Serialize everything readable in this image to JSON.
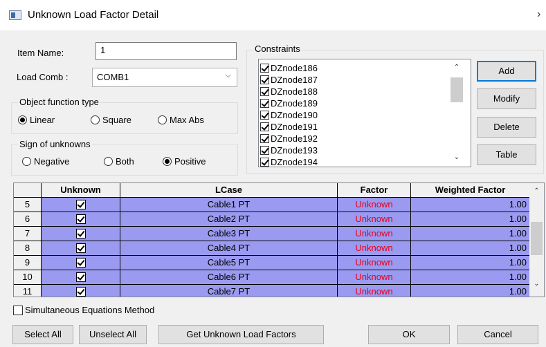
{
  "window": {
    "title": "Unknown Load Factor Detail",
    "close_glyph": "›"
  },
  "form": {
    "item_name_label": "Item Name:",
    "item_name_value": "1",
    "load_comb_label": "Load Comb :",
    "load_comb_value": "COMB1"
  },
  "objective": {
    "label": "Object function type",
    "options": [
      "Linear",
      "Square",
      "Max Abs"
    ],
    "selected": "Linear"
  },
  "sign": {
    "label": "Sign of unknowns",
    "options": [
      "Negative",
      "Both",
      "Positive"
    ],
    "selected": "Positive"
  },
  "constraints": {
    "label": "Constraints",
    "items": [
      "DZnode186",
      "DZnode187",
      "DZnode188",
      "DZnode189",
      "DZnode190",
      "DZnode191",
      "DZnode192",
      "DZnode193",
      "DZnode194"
    ],
    "buttons": [
      "Add",
      "Modify",
      "Delete",
      "Table"
    ]
  },
  "grid": {
    "columns": [
      "Unknown",
      "LCase",
      "Factor",
      "Weighted Factor"
    ],
    "rows": [
      {
        "num": "5",
        "lcase": "Cable1 PT",
        "factor": "Unknown",
        "weighted": "1.00"
      },
      {
        "num": "6",
        "lcase": "Cable2 PT",
        "factor": "Unknown",
        "weighted": "1.00"
      },
      {
        "num": "7",
        "lcase": "Cable3 PT",
        "factor": "Unknown",
        "weighted": "1.00"
      },
      {
        "num": "8",
        "lcase": "Cable4 PT",
        "factor": "Unknown",
        "weighted": "1.00"
      },
      {
        "num": "9",
        "lcase": "Cable5 PT",
        "factor": "Unknown",
        "weighted": "1.00"
      },
      {
        "num": "10",
        "lcase": "Cable6 PT",
        "factor": "Unknown",
        "weighted": "1.00"
      },
      {
        "num": "11",
        "lcase": "Cable7 PT",
        "factor": "Unknown",
        "weighted": "1.00"
      }
    ]
  },
  "simultaneous_label": "Simultaneous Equations Method",
  "footer": {
    "select_all": "Select All",
    "unselect_all": "Unselect All",
    "get_factors": "Get Unknown Load Factors",
    "ok": "OK",
    "cancel": "Cancel"
  },
  "colors": {
    "row_highlight": "#9a9af0",
    "unknown_text": "#e8001a",
    "focus_border": "#0078d7"
  },
  "icons": {
    "scroll_up": "▲",
    "scroll_down": "▼",
    "dropdown": "chevron-down-icon"
  }
}
